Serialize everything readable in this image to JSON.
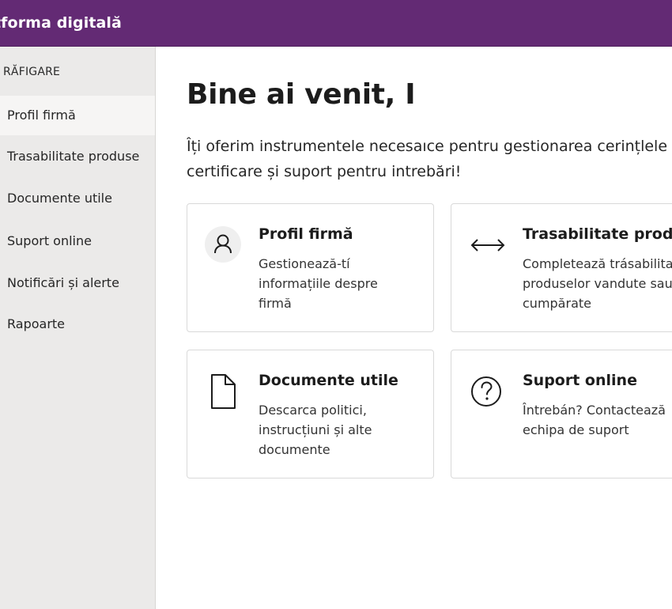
{
  "app": {
    "title": "tforma digitală"
  },
  "sidebar": {
    "header": "RĂFIGARE",
    "items": [
      {
        "label": "Profil firmă",
        "active": true
      },
      {
        "label": "Trasabilitate produse",
        "active": false
      },
      {
        "label": "Documente utile",
        "active": false
      },
      {
        "label": "Suport online",
        "active": false
      },
      {
        "label": "Notificări și alerte",
        "active": false
      },
      {
        "label": "Rapoarte",
        "active": false
      }
    ]
  },
  "main": {
    "title": "Bine ai venit, I",
    "intro": {
      "line1": "Îți oferim instrumentele necesaıce pentru gestionarea cerințlele",
      "line2": "certificare și suport pentru intrebări!"
    },
    "cards": [
      {
        "icon": "user-icon",
        "title": "Profil firmă",
        "desc": [
          "Gestionează-tí",
          "informațiile despre",
          "firmă"
        ]
      },
      {
        "icon": "arrows-left-right-icon",
        "title": "Trasabilitate produse",
        "desc": [
          "Completează trásabilitatea",
          "produselor vandute sau",
          "cumpărate"
        ]
      },
      {
        "icon": "document-icon",
        "title": "Documente utile",
        "desc": [
          "Descarca politici,",
          "instrucțiuni și alte",
          "documente"
        ]
      },
      {
        "icon": "help-circle-icon",
        "title": "Suport online",
        "desc": [
          "Întrebán? Contactează",
          "echipa de suport"
        ]
      }
    ]
  },
  "colors": {
    "topbar": "#632a74",
    "sidebar_bg": "#ebeae9",
    "sidebar_active": "#f6f5f4",
    "card_border": "#d9d9d9"
  }
}
